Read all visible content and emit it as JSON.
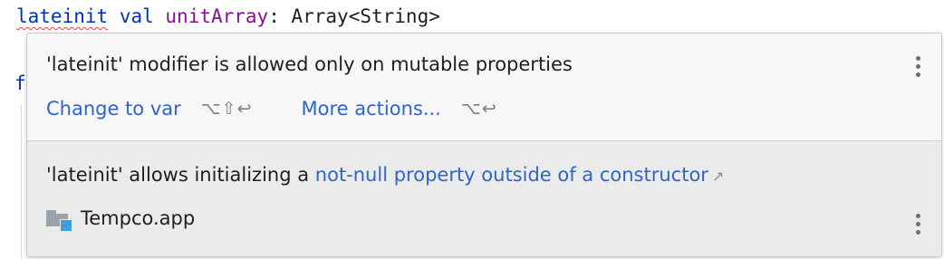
{
  "editor": {
    "code": {
      "keyword_lateinit": "lateinit",
      "keyword_val": "val",
      "identifier": "unitArray",
      "rest": ": Array<String>"
    },
    "gutter_char": "f"
  },
  "popup": {
    "problem_message": "'lateinit' modifier is allowed only on mutable properties",
    "actions": [
      {
        "label": "Change to var",
        "shortcut": "⌥⇧↩"
      },
      {
        "label": "More actions...",
        "shortcut": "⌥↩"
      }
    ],
    "doc": {
      "prefix": "'lateinit' allows initializing a ",
      "link": "not-null property outside of a constructor",
      "link_icon": "↗",
      "module_name": "Tempco.app"
    }
  },
  "colors": {
    "link": "#2f65ca",
    "error_underline": "#e0443e",
    "badge": "#3aa0e0"
  },
  "icons": [
    "more-vertical-icon",
    "external-link-icon",
    "module-folder-icon"
  ]
}
